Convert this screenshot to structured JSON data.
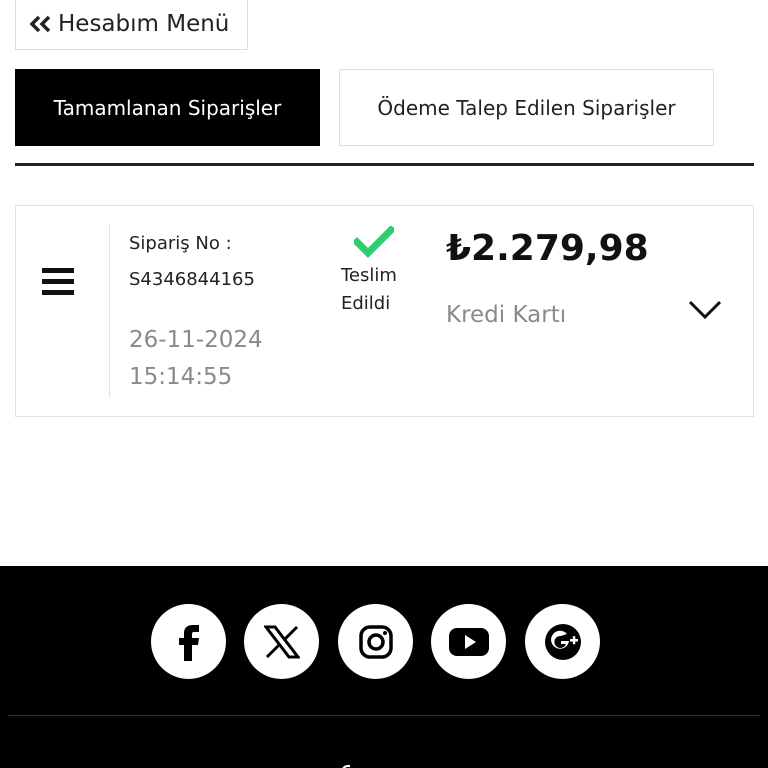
{
  "header": {
    "account_menu_label": "Hesabım Menü"
  },
  "tabs": [
    {
      "label": "Tamamlanan Siparişler",
      "active": true
    },
    {
      "label": "Ödeme Talep Edilen Siparişler",
      "active": false
    }
  ],
  "order": {
    "order_no_label": "Sipariş No :",
    "order_no": "S4346844165",
    "date": "26-11-2024",
    "time": "15:14:55",
    "status_line1": "Teslim",
    "status_line2": "Edildi",
    "amount": "₺2.279,98",
    "payment_method": "Kredi Kartı"
  },
  "footer": {
    "social_icons": [
      "facebook-icon",
      "x-icon",
      "instagram-icon",
      "youtube-icon",
      "google-plus-icon"
    ]
  },
  "colors": {
    "accent": "#000000",
    "status_green": "#2ecc71",
    "muted_text": "#8a8a8a",
    "footer_bg": "#000000"
  }
}
